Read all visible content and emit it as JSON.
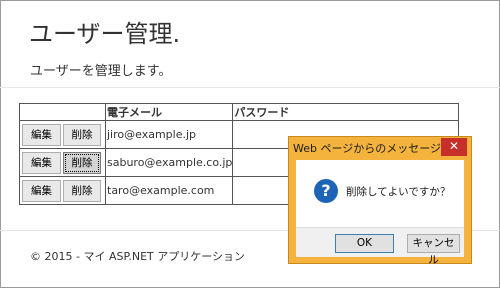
{
  "page": {
    "title": "ユーザー管理.",
    "subtitle": "ユーザーを管理します。"
  },
  "table": {
    "headers": [
      "",
      "電子メール",
      "パスワード"
    ],
    "rows": [
      {
        "edit": "編集",
        "delete": "削除",
        "email": "jiro@example.jp",
        "password": ""
      },
      {
        "edit": "編集",
        "delete": "削除",
        "email": "saburo@example.co.jp",
        "password": ""
      },
      {
        "edit": "編集",
        "delete": "削除",
        "email": "taro@example.com",
        "password": ""
      }
    ]
  },
  "footer": {
    "text": "© 2015 - マイ ASP.NET アプリケーション"
  },
  "dialog": {
    "title": "Web ページからのメッセージ",
    "close_label": "✕",
    "icon": "question-icon",
    "icon_glyph": "?",
    "message": "削除してよいですか？",
    "ok_label": "OK",
    "cancel_label": "キャンセル",
    "accent_color": "#f3b33d"
  }
}
